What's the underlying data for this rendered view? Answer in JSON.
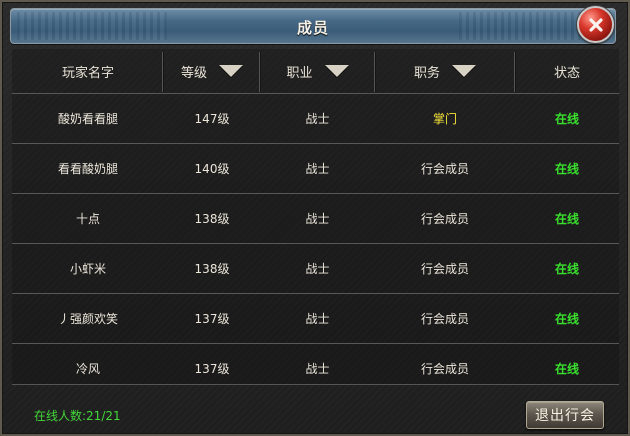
{
  "window": {
    "title": "成员"
  },
  "table": {
    "headers": [
      {
        "label": "玩家名字",
        "sortable": false
      },
      {
        "label": "等级",
        "sortable": true
      },
      {
        "label": "职业",
        "sortable": true
      },
      {
        "label": "职务",
        "sortable": true
      },
      {
        "label": "状态",
        "sortable": false
      }
    ],
    "rows": [
      {
        "name": "酸奶看看腿",
        "level": "147级",
        "job": "战士",
        "duty": "掌门",
        "status": "在线"
      },
      {
        "name": "看看酸奶腿",
        "level": "140级",
        "job": "战士",
        "duty": "行会成员",
        "status": "在线"
      },
      {
        "name": "十点",
        "level": "138级",
        "job": "战士",
        "duty": "行会成员",
        "status": "在线"
      },
      {
        "name": "小虾米",
        "level": "138级",
        "job": "战士",
        "duty": "行会成员",
        "status": "在线"
      },
      {
        "name": "丿强颜欢笑",
        "level": "137级",
        "job": "战士",
        "duty": "行会成员",
        "status": "在线"
      },
      {
        "name": "冷风",
        "level": "137级",
        "job": "战士",
        "duty": "行会成员",
        "status": "在线"
      }
    ]
  },
  "footer": {
    "online_count": "在线人数:21/21",
    "leave_button": "退出行会"
  },
  "colors": {
    "online_green": "#39e12d",
    "master_yellow": "#f4e33b",
    "title_blue": "#466987"
  },
  "icons": {
    "close": "close-icon",
    "sort": "triangle-down-icon"
  }
}
